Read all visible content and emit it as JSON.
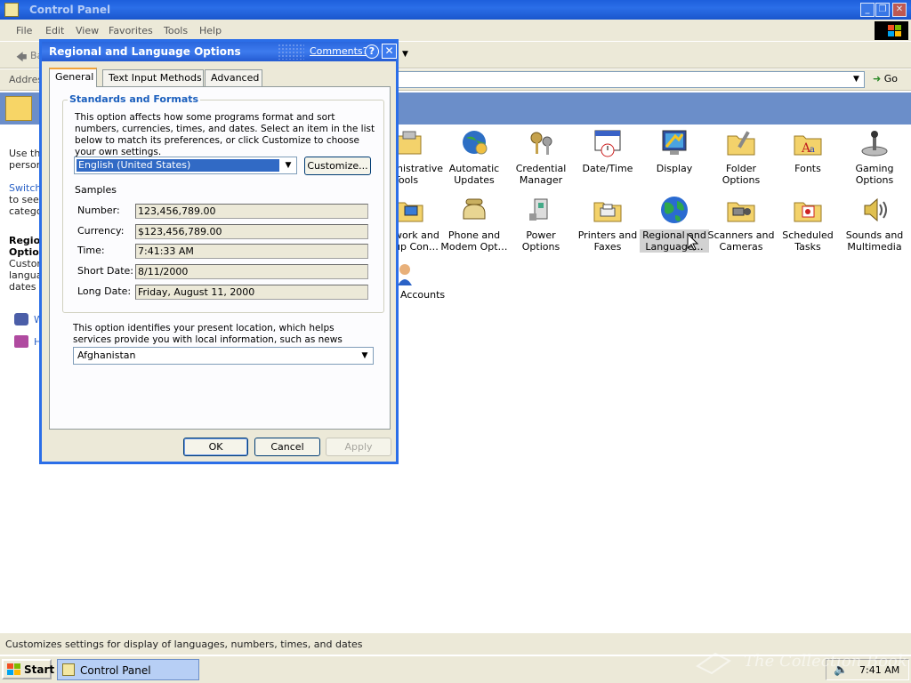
{
  "window": {
    "title": "Control Panel",
    "minimize": "_",
    "restore": "❐",
    "close": "✕"
  },
  "menu": [
    "File",
    "Edit",
    "View",
    "Favorites",
    "Tools",
    "Help"
  ],
  "toolbar": {
    "back_label": "Ba"
  },
  "address": {
    "label": "Addres",
    "go_label": "Go"
  },
  "left_pane": {
    "intro_lines": [
      "Use the",
      "person"
    ],
    "switch_lines": [
      "Switch",
      "to see",
      "catego"
    ],
    "title_lines": [
      "Regio",
      "Option"
    ],
    "desc_lines": [
      "Custom",
      "langua",
      "dates"
    ],
    "link1": "W",
    "link2": "H"
  },
  "icons": [
    {
      "name": "administrative-tools",
      "label": "inistrative Tools",
      "icon": "admin-tools-icon"
    },
    {
      "name": "automatic-updates",
      "label": "Automatic Updates",
      "icon": "globe-update-icon"
    },
    {
      "name": "credential-manager",
      "label": "Credential Manager",
      "icon": "keys-icon"
    },
    {
      "name": "date-time",
      "label": "Date/Time",
      "icon": "calendar-clock-icon"
    },
    {
      "name": "display",
      "label": "Display",
      "icon": "monitor-icon"
    },
    {
      "name": "folder-options",
      "label": "Folder Options",
      "icon": "folder-icon"
    },
    {
      "name": "fonts",
      "label": "Fonts",
      "icon": "fonts-folder-icon"
    },
    {
      "name": "gaming-options",
      "label": "Gaming Options",
      "icon": "joystick-icon"
    },
    {
      "name": "network-connections",
      "label": "work and up Con…",
      "icon": "network-icon"
    },
    {
      "name": "phone-modem",
      "label": "Phone and Modem Opt…",
      "icon": "phone-icon"
    },
    {
      "name": "power-options",
      "label": "Power Options",
      "icon": "power-icon"
    },
    {
      "name": "printers-faxes",
      "label": "Printers and Faxes",
      "icon": "printer-icon"
    },
    {
      "name": "regional-language",
      "label": "Regional and Language…",
      "icon": "globe-icon"
    },
    {
      "name": "scanners-cameras",
      "label": "Scanners and Cameras",
      "icon": "scanner-icon"
    },
    {
      "name": "scheduled-tasks",
      "label": "Scheduled Tasks",
      "icon": "scheduled-folder-icon"
    },
    {
      "name": "sounds-multimedia",
      "label": "Sounds and Multimedia",
      "icon": "speaker-icon"
    },
    {
      "name": "user-accounts",
      "label": "Accounts",
      "icon": "users-icon"
    }
  ],
  "status_text": "Customizes settings for display of languages, numbers, times, and dates",
  "taskbar": {
    "start_label": "Start",
    "task_label": "Control Panel",
    "clock": "7:41 AM"
  },
  "watermark": "The Collection Book",
  "dialog": {
    "title": "Regional and Language Options",
    "comments_link": "Comments?",
    "help_label": "?",
    "close_label": "✕",
    "tabs": [
      "General",
      "Text Input Methods",
      "Advanced"
    ],
    "group_title": "Standards and Formats",
    "group_desc": "This option affects how some programs format and sort numbers, currencies, times, and dates. Select an item in the list below to match its preferences, or click Customize to choose your own settings.",
    "locale_value": "English (United States)",
    "customize_label": "Customize...",
    "samples_label": "Samples",
    "samples": [
      {
        "label": "Number:",
        "value": "123,456,789.00"
      },
      {
        "label": "Currency:",
        "value": "$123,456,789.00"
      },
      {
        "label": "Time:",
        "value": "7:41:33 AM"
      },
      {
        "label": "Short Date:",
        "value": "8/11/2000"
      },
      {
        "label": "Long Date:",
        "value": "Friday, August 11, 2000"
      }
    ],
    "location_desc": "This option identifies your present location, which helps services provide you with local information, such as news and weather.",
    "location_value": "Afghanistan",
    "ok_label": "OK",
    "cancel_label": "Cancel",
    "apply_label": "Apply"
  }
}
